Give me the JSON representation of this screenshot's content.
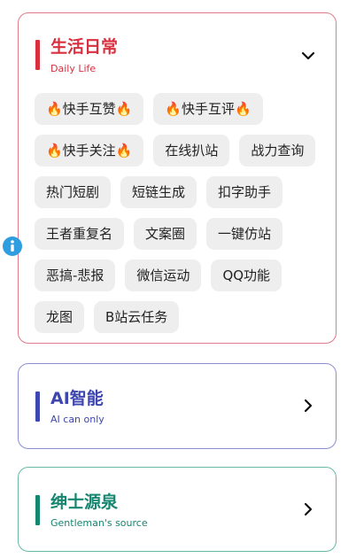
{
  "daily": {
    "title": "生活日常",
    "subtitle": "Daily Life",
    "accent": "#d8303f",
    "tags": [
      "🔥快手互赞🔥",
      "🔥快手互评🔥",
      "🔥快手关注🔥",
      "在线扒站",
      "战力查询",
      "热门短剧",
      "短链生成",
      "扣字助手",
      "王者重复名",
      "文案圈",
      "一键仿站",
      "恶搞-悲报",
      "微信运动",
      "QQ功能",
      "龙图",
      "B站云任务"
    ]
  },
  "ai": {
    "title": "AI智能",
    "subtitle": "AI can only",
    "accent": "#3e46b0"
  },
  "gentleman": {
    "title": "绅士源泉",
    "subtitle": "Gentleman's source",
    "accent": "#15866f"
  },
  "icons": {
    "expand": "chevron-down-icon",
    "open": "chevron-right-icon",
    "info": "info-icon"
  }
}
